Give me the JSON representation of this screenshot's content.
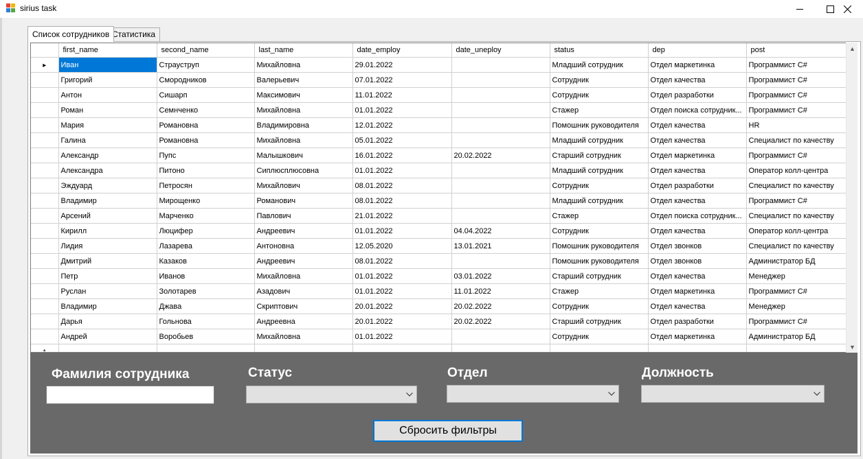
{
  "window": {
    "title": "sirius task"
  },
  "tabs": [
    {
      "label": "Список сотрудников"
    },
    {
      "label": "Статистика"
    }
  ],
  "grid": {
    "columns": [
      "first_name",
      "second_name",
      "last_name",
      "date_employ",
      "date_uneploy",
      "status",
      "dep",
      "post"
    ],
    "rows": [
      [
        "Иван",
        "Страуструп",
        "Михайловна",
        "29.01.2022",
        "",
        "Младший сотрудник",
        "Отдел маркетинка",
        "Программист C#"
      ],
      [
        "Григорий",
        "Смородников",
        "Валерьевич",
        "07.01.2022",
        "",
        "Сотрудник",
        "Отдел качества",
        "Программист C#"
      ],
      [
        "Антон",
        "Сишарп",
        "Максимович",
        "11.01.2022",
        "",
        "Сотрудник",
        "Отдел разработки",
        "Программист C#"
      ],
      [
        "Роман",
        "Семнченко",
        "Михайловна",
        "01.01.2022",
        "",
        "Стажер",
        "Отдел поиска сотрудник...",
        "Программист C#"
      ],
      [
        "Мария",
        "Романовна",
        "Владимировна",
        "12.01.2022",
        "",
        "Помошник руководителя",
        "Отдел качества",
        "HR"
      ],
      [
        "Галина",
        "Романовна",
        "Михайловна",
        "05.01.2022",
        "",
        "Младший сотрудник",
        "Отдел качества",
        "Специалист по качеству"
      ],
      [
        "Александр",
        "Пупс",
        "Малышкович",
        "16.01.2022",
        "20.02.2022",
        "Старший сотрудник",
        "Отдел маркетинка",
        "Программист C#"
      ],
      [
        "Александра",
        "Питоно",
        "Сиплюсплюсовна",
        "01.01.2022",
        "",
        "Младший сотрудник",
        "Отдел качества",
        "Оператор колл-центра"
      ],
      [
        "Эждуард",
        "Петросян",
        "Михайлович",
        "08.01.2022",
        "",
        "Сотрудник",
        "Отдел разработки",
        "Специалист по качеству"
      ],
      [
        "Владимир",
        "Мирощенко",
        "Романович",
        "08.01.2022",
        "",
        "Младший сотрудник",
        "Отдел качества",
        "Программист C#"
      ],
      [
        "Арсений",
        "Марченко",
        "Павлович",
        "21.01.2022",
        "",
        "Стажер",
        "Отдел поиска сотрудник...",
        "Специалист по качеству"
      ],
      [
        "Кирилл",
        "Люцифер",
        "Андреевич",
        "01.01.2022",
        "04.04.2022",
        "Сотрудник",
        "Отдел качества",
        "Оператор колл-центра"
      ],
      [
        "Лидия",
        "Лазарева",
        "Антоновна",
        "12.05.2020",
        "13.01.2021",
        "Помошник руководителя",
        "Отдел звонков",
        "Специалист по качеству"
      ],
      [
        "Дмитрий",
        "Казаков",
        "Андреевич",
        "08.01.2022",
        "",
        "Помошник руководителя",
        "Отдел звонков",
        "Администратор БД"
      ],
      [
        "Петр",
        "Иванов",
        "Михайловна",
        "01.01.2022",
        "03.01.2022",
        "Старший сотрудник",
        "Отдел качества",
        "Менеджер"
      ],
      [
        "Руслан",
        "Золотарев",
        "Азадович",
        "01.01.2022",
        "11.01.2022",
        "Стажер",
        "Отдел маркетинка",
        "Программист C#"
      ],
      [
        "Владимир",
        "Джава",
        "Скриптович",
        "20.01.2022",
        "20.02.2022",
        "Сотрудник",
        "Отдел качества",
        "Менеджер"
      ],
      [
        "Дарья",
        "Гольнова",
        "Андреевна",
        "20.01.2022",
        "20.02.2022",
        "Старший сотрудник",
        "Отдел разработки",
        "Программист C#"
      ],
      [
        "Андрей",
        "Воробьев",
        "Михайловна",
        "01.01.2022",
        "",
        "Сотрудник",
        "Отдел маркетинка",
        "Администратор БД"
      ]
    ],
    "current_row_marker": "▸",
    "new_row_marker": "*"
  },
  "filters": {
    "last_name_label": "Фамилия сотрудника",
    "last_name_value": "",
    "status_label": "Статус",
    "status_value": "",
    "dep_label": "Отдел",
    "dep_value": "",
    "post_label": "Должность",
    "post_value": "",
    "reset_label": "Сбросить фильтры"
  },
  "colors": {
    "filter_panel_bg": "#696969",
    "selection": "#0078d7",
    "button_focus_border": "#0078d7"
  }
}
